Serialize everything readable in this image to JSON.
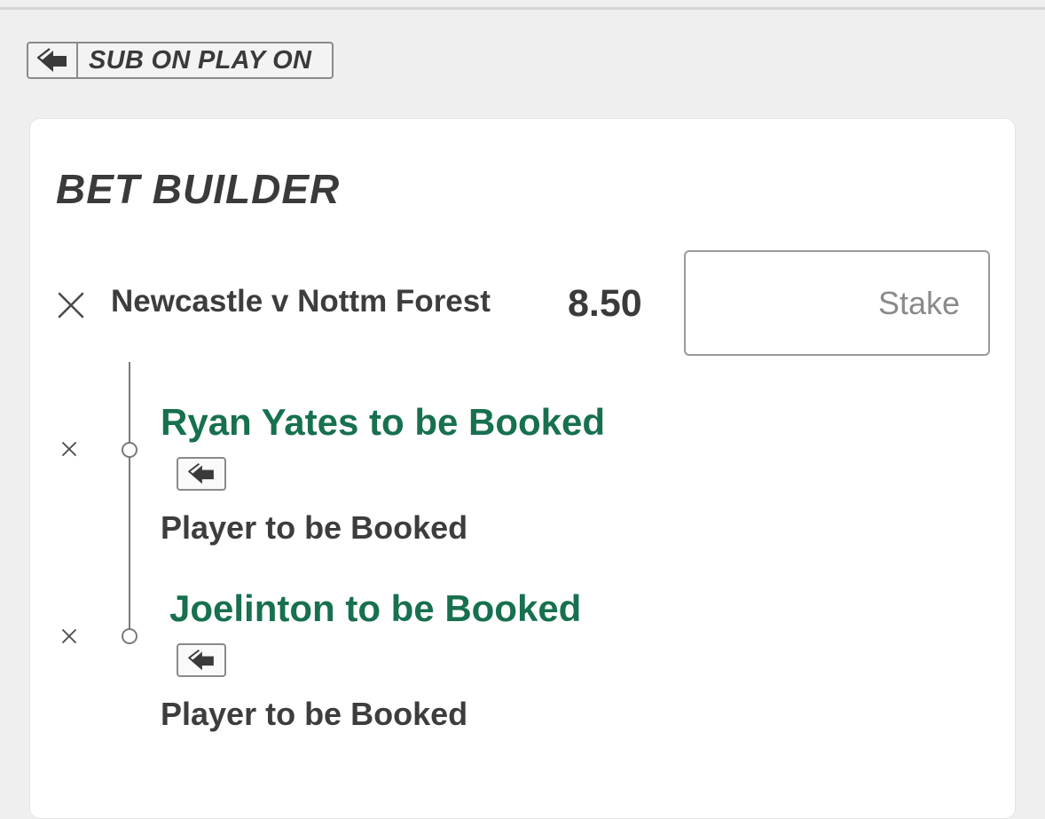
{
  "sub_on_play_on": {
    "label": "SUB ON PLAY ON",
    "icon": "swap-arrows-icon"
  },
  "bet_builder": {
    "title": "BET BUILDER",
    "event": "Newcastle v Nottm Forest",
    "odds": "8.50",
    "stake_placeholder": "Stake",
    "stake_value": "",
    "legs": [
      {
        "selection": "Ryan Yates to be Booked",
        "market": "Player to be Booked",
        "icon": "swap-arrows-icon"
      },
      {
        "selection": "Joelinton to be Booked",
        "market": "Player to be Booked",
        "icon": "swap-arrows-icon"
      }
    ]
  },
  "colors": {
    "selection_green": "#17704e",
    "text_dark": "#3d3d3d",
    "background": "#efefef"
  }
}
